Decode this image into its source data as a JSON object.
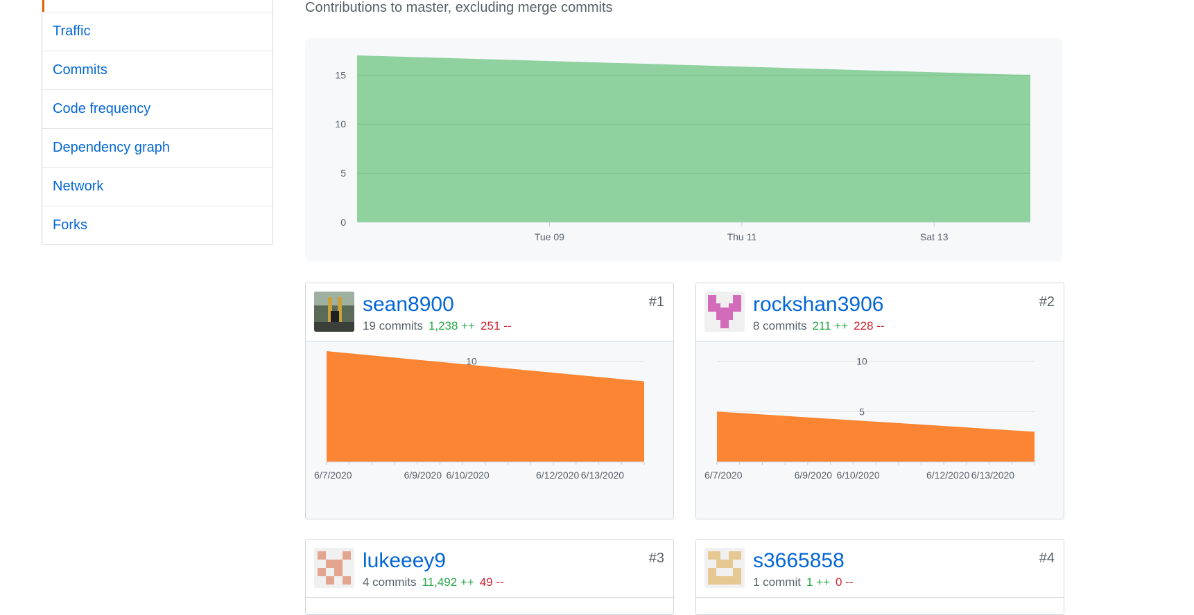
{
  "sidebar": {
    "items": [
      {
        "label": ""
      },
      {
        "label": "Traffic"
      },
      {
        "label": "Commits"
      },
      {
        "label": "Code frequency"
      },
      {
        "label": "Dependency graph"
      },
      {
        "label": "Network"
      },
      {
        "label": "Forks"
      }
    ]
  },
  "subtitle": "Contributions to master, excluding merge commits",
  "colors": {
    "link": "#0366d6",
    "additions": "#28a745",
    "deletions": "#cb2431",
    "main_area": "#8dd09d",
    "contributor_area": "#fb8532",
    "selected_tab_border": "#e36209"
  },
  "chart_data": [
    {
      "type": "area",
      "x": [
        "2020-06-07",
        "2020-06-14"
      ],
      "y": [
        17,
        15
      ],
      "xtick_labels": [
        "Tue 09",
        "Thu 11",
        "Sat 13"
      ],
      "ytick_labels": [
        "0",
        "5",
        "10",
        "15"
      ],
      "ylim": [
        0,
        17
      ],
      "grid": true,
      "color": "#8dd09d"
    },
    {
      "type": "area",
      "contributor": "sean8900",
      "x": [
        "2020-06-07",
        "2020-06-14"
      ],
      "y": [
        11,
        8
      ],
      "xtick_labels": [
        "6/7/2020",
        "6/9/2020",
        "6/10/2020",
        "6/12/2020",
        "6/13/2020"
      ],
      "ytick_labels": [
        "10"
      ],
      "ylim": [
        0,
        11
      ],
      "color": "#fb8532"
    },
    {
      "type": "area",
      "contributor": "rockshan3906",
      "x": [
        "2020-06-07",
        "2020-06-14"
      ],
      "y": [
        5,
        3
      ],
      "xtick_labels": [
        "6/7/2020",
        "6/9/2020",
        "6/10/2020",
        "6/12/2020",
        "6/13/2020"
      ],
      "ytick_labels": [
        "10",
        "5"
      ],
      "ylim": [
        0,
        11
      ],
      "color": "#fb8532"
    }
  ],
  "contributors": [
    {
      "rank": "#1",
      "name": "sean8900",
      "commits": "19 commits",
      "additions": "1,238 ++",
      "deletions": "251 --",
      "avatar": "photo"
    },
    {
      "rank": "#2",
      "name": "rockshan3906",
      "commits": "8 commits",
      "additions": "211 ++",
      "deletions": "228 --",
      "avatar": "identicon-heart",
      "avatar_color": "#d16bba"
    },
    {
      "rank": "#3",
      "name": "lukeeey9",
      "commits": "4 commits",
      "additions": "11,492 ++",
      "deletions": "49 --",
      "avatar": "identicon",
      "avatar_color": "#e2a58f"
    },
    {
      "rank": "#4",
      "name": "s3665858",
      "commits": "1 commit",
      "additions": "1 ++",
      "deletions": "0 --",
      "avatar": "identicon",
      "avatar_color": "#e6c893"
    }
  ]
}
